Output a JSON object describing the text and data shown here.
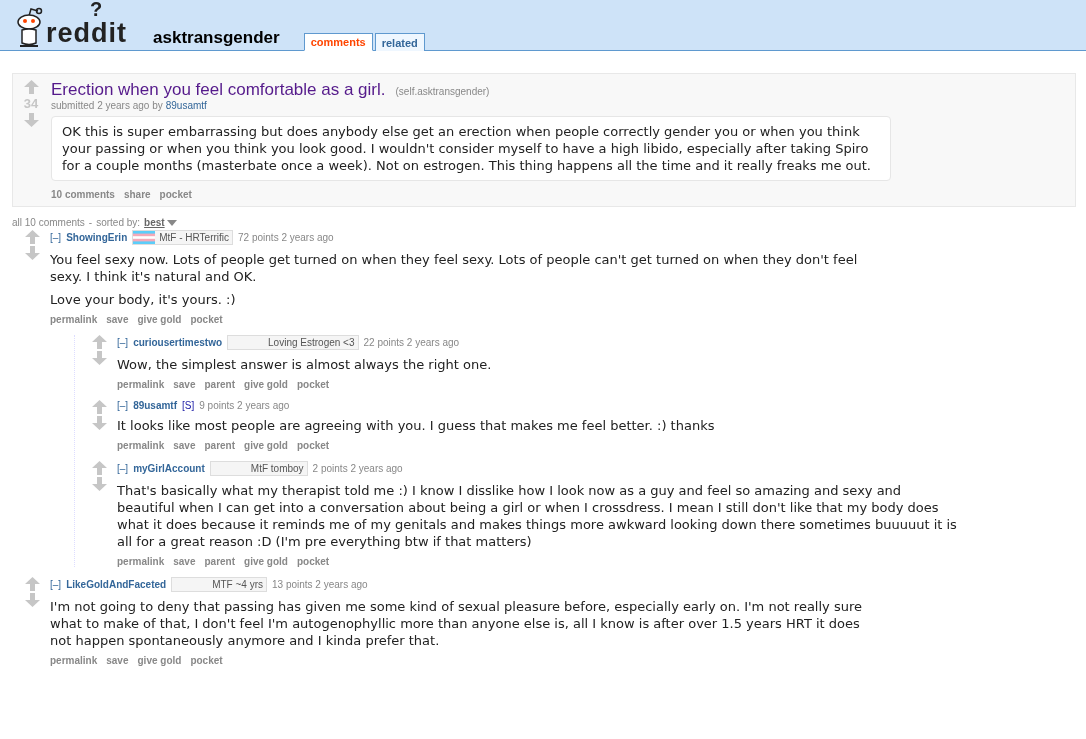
{
  "header": {
    "logo_text": "reddit",
    "logo_mark": "?",
    "subreddit": "asktransgender",
    "tabs": [
      {
        "label": "comments",
        "selected": true
      },
      {
        "label": "related",
        "selected": false
      }
    ]
  },
  "post": {
    "score": "34",
    "title": "Erection when you feel comfortable as a girl.",
    "domain": "(self.asktransgender)",
    "tagline_prefix": "submitted 2 years ago by",
    "author": "89usamtf",
    "body": "OK this is super embarrassing but does anybody else get an erection when people correctly gender you or when you think your passing or when you think you look good. I wouldn't consider myself to have a high libido, especially after taking Spiro for a couple months (masterbate once a week). Not on estrogen. This thing happens all the time and it really freaks me out.",
    "buttons": [
      "10 comments",
      "share",
      "pocket"
    ]
  },
  "comment_area": {
    "count": "all 10 comments",
    "separator": "-",
    "sort_label": "sorted by:",
    "sort_value": "best"
  },
  "comments": [
    {
      "collapse": "[–]",
      "author": "ShowingErin",
      "flair_icon": true,
      "flair": "MtF - HRTerrific",
      "points": "72 points 2 years ago",
      "paragraphs": [
        "You feel sexy now. Lots of people get turned on when they feel sexy. Lots of people can't get turned on when they don't feel sexy. I think it's natural and OK.",
        "Love your body, it's yours. :)"
      ],
      "buttons": [
        "permalink",
        "save",
        "give gold",
        "pocket"
      ],
      "children": [
        {
          "collapse": "[–]",
          "author": "curiousertimestwo",
          "flair_icon": false,
          "flair": "Loving Estrogen <3",
          "points": "22 points 2 years ago",
          "paragraphs": [
            "Wow, the simplest answer is almost always the right one."
          ],
          "buttons": [
            "permalink",
            "save",
            "parent",
            "give gold",
            "pocket"
          ]
        },
        {
          "collapse": "[–]",
          "author": "89usamtf",
          "submitter_tag": "[S]",
          "points": "9 points 2 years ago",
          "paragraphs": [
            "It looks like most people are agreeing with you. I guess that makes me feel better. :) thanks"
          ],
          "buttons": [
            "permalink",
            "save",
            "parent",
            "give gold",
            "pocket"
          ]
        },
        {
          "collapse": "[–]",
          "author": "myGirlAccount",
          "flair_icon": false,
          "flair": "MtF tomboy",
          "points": "2 points 2 years ago",
          "paragraphs": [
            "That's basically what my therapist told me :) I know I disslike how I look now as a guy and feel so amazing and sexy and beautiful when I can get into a conversation about being a girl or when I crossdress. I mean I still don't like that my body does what it does because it reminds me of my genitals and makes things more awkward looking down there sometimes buuuuut it is all for a great reason :D (I'm pre everything btw if that matters)"
          ],
          "buttons": [
            "permalink",
            "save",
            "parent",
            "give gold",
            "pocket"
          ]
        }
      ]
    },
    {
      "collapse": "[–]",
      "author": "LikeGoldAndFaceted",
      "flair_icon": false,
      "flair": "MTF ~4 yrs",
      "points": "13 points 2 years ago",
      "paragraphs": [
        "I'm not going to deny that passing has given me some kind of sexual pleasure before, especially early on. I'm not really sure what to make of that, I don't feel I'm autogenophyllic more than anyone else is, all I know is after over 1.5 years HRT it does not happen spontaneously anymore and I kinda prefer that."
      ],
      "buttons": [
        "permalink",
        "save",
        "give gold",
        "pocket"
      ]
    }
  ]
}
